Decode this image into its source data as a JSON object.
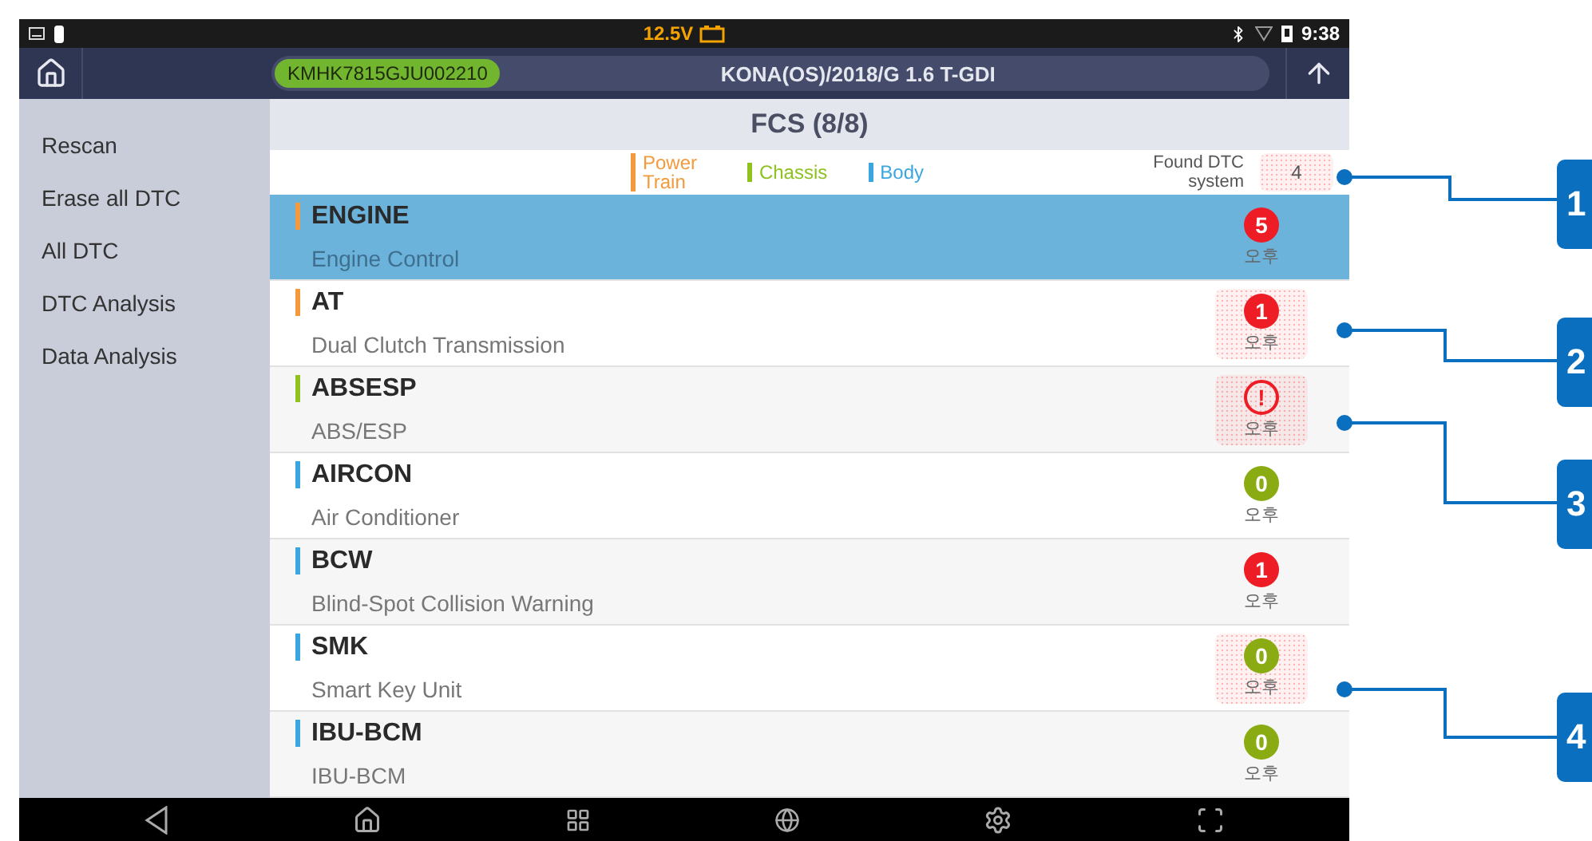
{
  "status_bar": {
    "voltage": "12.5V",
    "time": "9:38"
  },
  "header": {
    "vin": "KMHK7815GJU002210",
    "vehicle": "KONA(OS)/2018/G 1.6 T-GDI"
  },
  "sidebar": {
    "items": [
      "Rescan",
      "Erase all DTC",
      "All DTC",
      "DTC Analysis",
      "Data Analysis"
    ]
  },
  "panel": {
    "title": "FCS (8/8)",
    "legend": [
      {
        "label": "Power Train",
        "color": "#f39a3c"
      },
      {
        "label": "Chassis",
        "color": "#8dc21f"
      },
      {
        "label": "Body",
        "color": "#3aa6e0"
      }
    ],
    "found": {
      "label": "Found DTC system",
      "count": "4",
      "highlighted": true
    }
  },
  "systems": [
    {
      "name": "ENGINE",
      "description": "Engine Control",
      "color": "#f39a3c",
      "selected": true,
      "badge": {
        "kind": "count",
        "value": "5",
        "color": "#ee1c25",
        "highlighted": false
      },
      "time": "오후"
    },
    {
      "name": "AT",
      "description": "Dual Clutch Transmission",
      "color": "#f39a3c",
      "selected": false,
      "badge": {
        "kind": "count",
        "value": "1",
        "color": "#ee1c25",
        "highlighted": true
      },
      "time": "오후"
    },
    {
      "name": "ABSESP",
      "description": "ABS/ESP",
      "color": "#8dc21f",
      "selected": false,
      "badge": {
        "kind": "alert",
        "value": "!",
        "color": "#ee1c25",
        "highlighted": true
      },
      "time": "오후"
    },
    {
      "name": "AIRCON",
      "description": "Air Conditioner",
      "color": "#3aa6e0",
      "selected": false,
      "badge": {
        "kind": "count",
        "value": "0",
        "color": "#8aac12",
        "highlighted": false
      },
      "time": "오후"
    },
    {
      "name": "BCW",
      "description": "Blind-Spot Collision Warning",
      "color": "#3aa6e0",
      "selected": false,
      "badge": {
        "kind": "count",
        "value": "1",
        "color": "#ee1c25",
        "highlighted": false
      },
      "time": "오후"
    },
    {
      "name": "SMK",
      "description": "Smart Key Unit",
      "color": "#3aa6e0",
      "selected": false,
      "badge": {
        "kind": "count",
        "value": "0",
        "color": "#8aac12",
        "highlighted": true
      },
      "time": "오후"
    },
    {
      "name": "IBU-BCM",
      "description": "IBU-BCM",
      "color": "#3aa6e0",
      "selected": false,
      "badge": {
        "kind": "count",
        "value": "0",
        "color": "#8aac12",
        "highlighted": false
      },
      "time": "오후"
    }
  ],
  "callouts": [
    {
      "number": "1"
    },
    {
      "number": "2"
    },
    {
      "number": "3"
    },
    {
      "number": "4"
    }
  ]
}
